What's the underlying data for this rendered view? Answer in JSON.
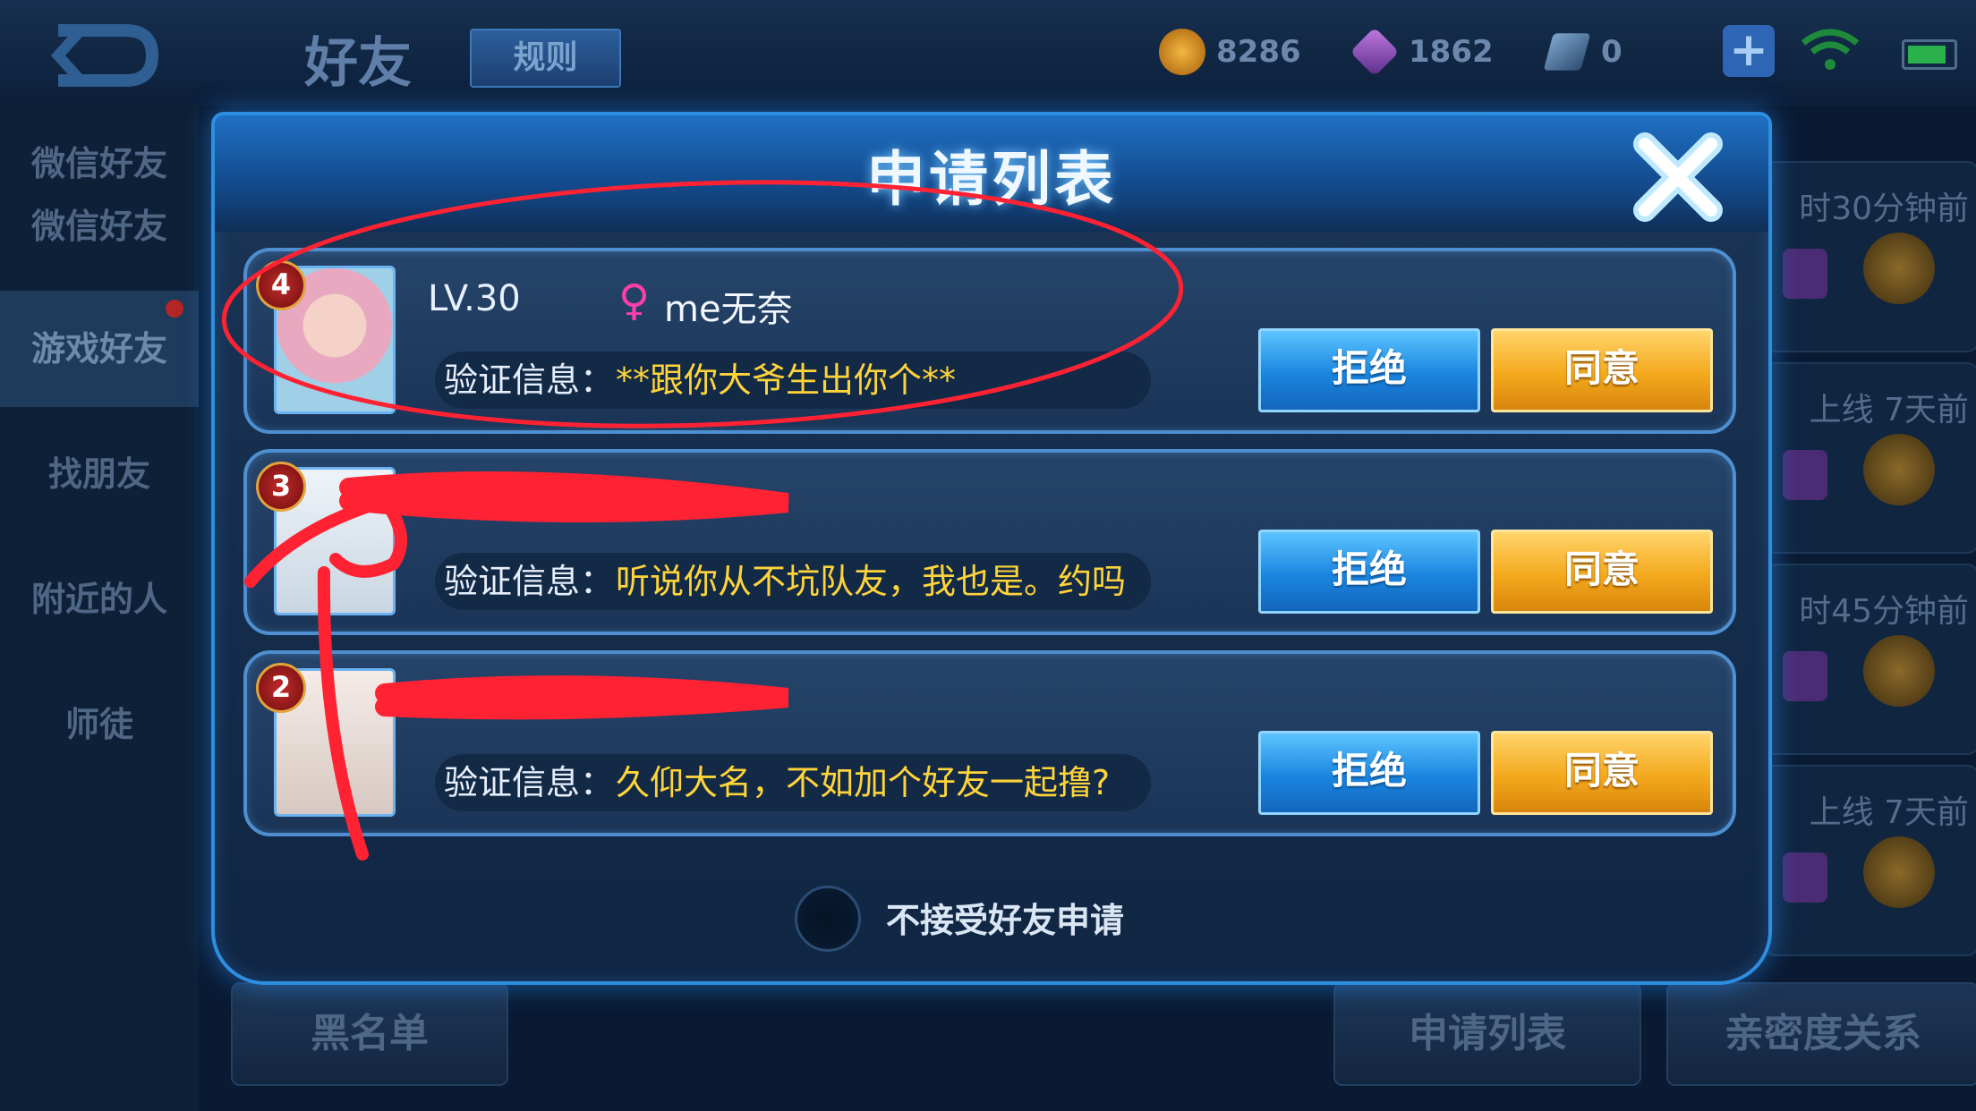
{
  "topbar": {
    "title": "好友",
    "rules_label": "规则",
    "gold": "8286",
    "gems": "1862",
    "tickets": "0"
  },
  "left_nav": [
    {
      "label": "微信好友"
    },
    {
      "label": "游戏好友"
    },
    {
      "label": "找朋友"
    },
    {
      "label": "附近的人"
    },
    {
      "label": "师徒"
    }
  ],
  "right_list": [
    {
      "text": "时30分钟前"
    },
    {
      "text": "上线  7天前"
    },
    {
      "text": "时45分钟前"
    },
    {
      "text": "上线  7天前"
    }
  ],
  "bottom": {
    "blacklist": "黑名单",
    "apply_list": "申请列表",
    "intimacy": "亲密度关系"
  },
  "modal": {
    "title": "申请列表",
    "verify_label": "验证信息：",
    "reject_label": "拒绝",
    "accept_label": "同意",
    "decline_all_label": "不接受好友申请",
    "requests": [
      {
        "rank": "4",
        "level": "LV.30",
        "gender": "♀",
        "name": "me无奈",
        "message": "**跟你大爷生出你个**"
      },
      {
        "rank": "3",
        "level": "",
        "gender": "",
        "name": "",
        "message": "听说你从不坑队友，我也是。约吗"
      },
      {
        "rank": "2",
        "level": "",
        "gender": "",
        "name": "",
        "message": "久仰大名，不如加个好友一起撸?"
      }
    ]
  },
  "colors": {
    "accent_blue": "#1a85e0",
    "accept_orange": "#f4a91d",
    "message_yellow": "#ffd43a",
    "annotation_red": "#ff2233"
  }
}
